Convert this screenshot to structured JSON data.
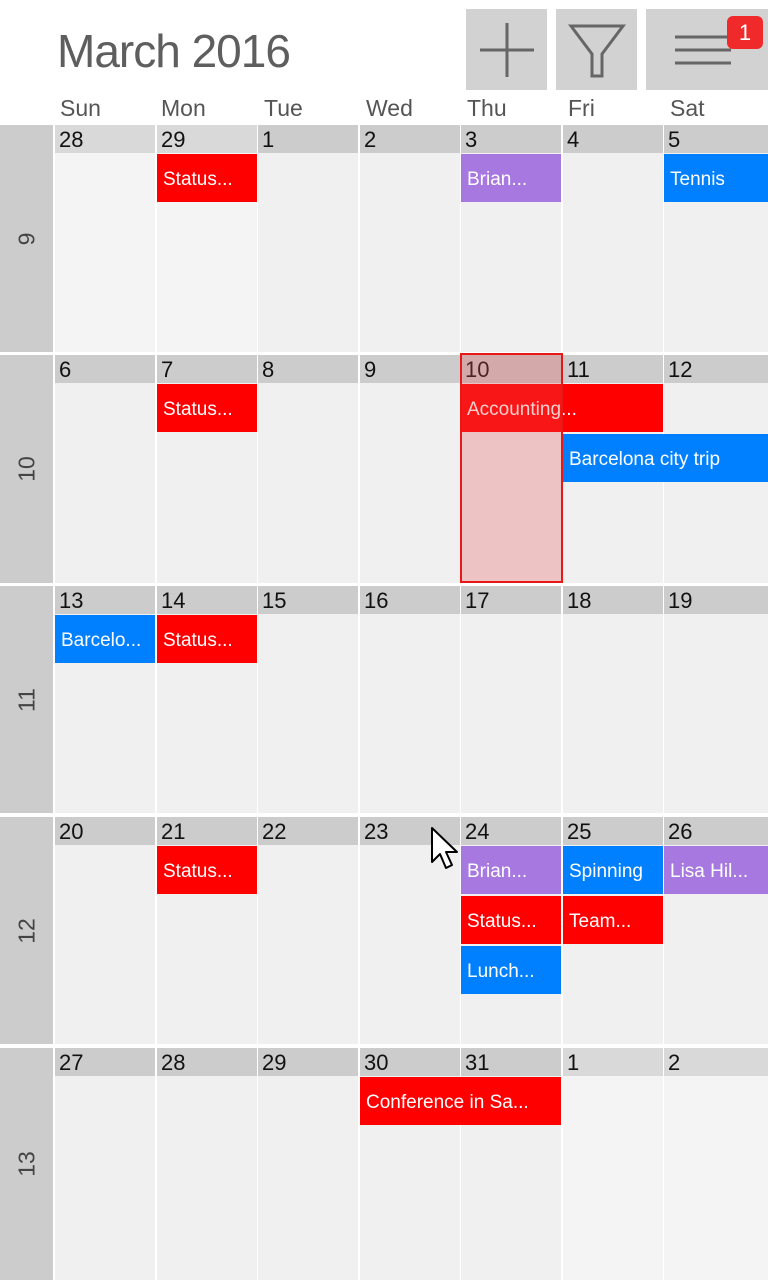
{
  "header": {
    "title": "March 2016",
    "buttons": [
      {
        "name": "add-button",
        "icon": "plus-icon"
      },
      {
        "name": "filter-button",
        "icon": "filter-icon"
      },
      {
        "name": "menu-button",
        "icon": "hamburger-menu-icon",
        "badge": "1"
      }
    ]
  },
  "days_of_week": [
    "Sun",
    "Mon",
    "Tue",
    "Wed",
    "Thu",
    "Fri",
    "Sat"
  ],
  "colors": {
    "red": "#ff0000",
    "blue": "#0080ff",
    "purple": "#a678e0",
    "today_border": "#e81818",
    "week_label_bg": "#cccccc",
    "badge": "#f02a2a"
  },
  "today": {
    "week": 1,
    "day": 4,
    "date": "10"
  },
  "weeks": [
    {
      "number": "9",
      "dates": [
        "28",
        "29",
        "1",
        "2",
        "3",
        "4",
        "5"
      ],
      "other_month": [
        true,
        true,
        false,
        false,
        false,
        false,
        false
      ]
    },
    {
      "number": "10",
      "dates": [
        "6",
        "7",
        "8",
        "9",
        "10",
        "11",
        "12"
      ],
      "other_month": [
        false,
        false,
        false,
        false,
        false,
        false,
        false
      ]
    },
    {
      "number": "11",
      "dates": [
        "13",
        "14",
        "15",
        "16",
        "17",
        "18",
        "19"
      ],
      "other_month": [
        false,
        false,
        false,
        false,
        false,
        false,
        false
      ]
    },
    {
      "number": "12",
      "dates": [
        "20",
        "21",
        "22",
        "23",
        "24",
        "25",
        "26"
      ],
      "other_month": [
        false,
        false,
        false,
        false,
        false,
        false,
        false
      ]
    },
    {
      "number": "13",
      "dates": [
        "27",
        "28",
        "29",
        "30",
        "31",
        "1",
        "2"
      ],
      "other_month": [
        false,
        false,
        false,
        false,
        false,
        true,
        true
      ]
    }
  ],
  "events": [
    {
      "week": 0,
      "day": 1,
      "span": 1,
      "row": 0,
      "label": "Status...",
      "color": "red"
    },
    {
      "week": 0,
      "day": 4,
      "span": 1,
      "row": 0,
      "label": "Brian...",
      "color": "purple"
    },
    {
      "week": 0,
      "day": 6,
      "span": 1,
      "row": 0,
      "label": "Tennis",
      "color": "blue"
    },
    {
      "week": 1,
      "day": 1,
      "span": 1,
      "row": 0,
      "label": "Status...",
      "color": "red"
    },
    {
      "week": 1,
      "day": 4,
      "span": 2,
      "row": 0,
      "label": "Accounting...",
      "color": "red"
    },
    {
      "week": 1,
      "day": 5,
      "span": 2,
      "row": 1,
      "label": "Barcelona city trip",
      "color": "blue"
    },
    {
      "week": 2,
      "day": 0,
      "span": 1,
      "row": 0,
      "label": "Barcelo...",
      "color": "blue"
    },
    {
      "week": 2,
      "day": 1,
      "span": 1,
      "row": 0,
      "label": "Status...",
      "color": "red"
    },
    {
      "week": 3,
      "day": 1,
      "span": 1,
      "row": 0,
      "label": "Status...",
      "color": "red"
    },
    {
      "week": 3,
      "day": 4,
      "span": 1,
      "row": 0,
      "label": "Brian...",
      "color": "purple"
    },
    {
      "week": 3,
      "day": 5,
      "span": 1,
      "row": 0,
      "label": "Spinning",
      "color": "blue"
    },
    {
      "week": 3,
      "day": 6,
      "span": 1,
      "row": 0,
      "label": "Lisa Hil...",
      "color": "purple"
    },
    {
      "week": 3,
      "day": 4,
      "span": 1,
      "row": 1,
      "label": "Status...",
      "color": "red"
    },
    {
      "week": 3,
      "day": 5,
      "span": 1,
      "row": 1,
      "label": "Team...",
      "color": "red"
    },
    {
      "week": 3,
      "day": 4,
      "span": 1,
      "row": 2,
      "label": "Lunch...",
      "color": "blue"
    },
    {
      "week": 4,
      "day": 3,
      "span": 2,
      "row": 0,
      "label": "Conference in Sa...",
      "color": "red"
    }
  ]
}
